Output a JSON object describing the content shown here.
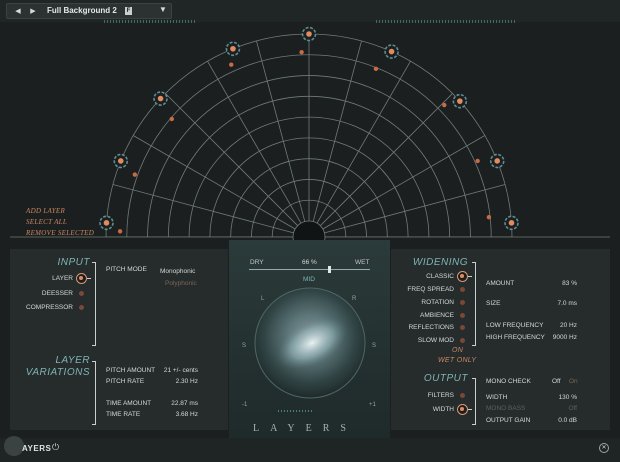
{
  "toolbar": {
    "prev": "◀",
    "next": "▶",
    "preset_name": "Full Background 2",
    "flag": "F",
    "caret": "▼"
  },
  "sound_field": {
    "actions": [
      "ADD LAYER",
      "SELECT ALL",
      "REMOVE SELECTED"
    ]
  },
  "input": {
    "title": "INPUT",
    "items": [
      {
        "label": "LAYER",
        "active": true
      },
      {
        "label": "DEESSER",
        "active": false
      },
      {
        "label": "COMPRESSOR",
        "active": false
      }
    ],
    "pitch_mode_label": "PITCH MODE",
    "pitch_mode_options": [
      "Monophonic",
      "Polyphonic"
    ]
  },
  "layer_variations": {
    "title_line1": "LAYER",
    "title_line2": "VARIATIONS",
    "params": [
      {
        "label": "PITCH AMOUNT",
        "value": "21 +/- cents"
      },
      {
        "label": "PITCH RATE",
        "value": "2.30 Hz"
      },
      {
        "label": "TIME AMOUNT",
        "value": "22.87 ms"
      },
      {
        "label": "TIME RATE",
        "value": "3.68 Hz"
      }
    ]
  },
  "mix": {
    "dry": "DRY",
    "wet": "WET",
    "value": "66 %",
    "fraction": 0.66
  },
  "scope": {
    "mid": "MID",
    "l": "L",
    "r": "R",
    "s_left": "S",
    "s_right": "S",
    "minus": "-1",
    "plus": "+1",
    "logo": "LAYERS"
  },
  "widening": {
    "title": "WIDENING",
    "modes": [
      {
        "label": "CLASSIC",
        "active": true
      },
      {
        "label": "FREQ SPREAD",
        "active": false
      },
      {
        "label": "ROTATION",
        "active": false
      },
      {
        "label": "AMBIENCE",
        "active": false
      },
      {
        "label": "REFLECTIONS",
        "active": false
      },
      {
        "label": "SLOW MOD",
        "active": false
      }
    ],
    "on": "ON",
    "wet_only": "WET ONLY",
    "params": [
      {
        "label": "AMOUNT",
        "value": "83 %"
      },
      {
        "label": "SIZE",
        "value": "7.0 ms"
      },
      {
        "label": "LOW FREQUENCY",
        "value": "20 Hz"
      },
      {
        "label": "HIGH FREQUENCY",
        "value": "9000 Hz"
      }
    ]
  },
  "output": {
    "title": "OUTPUT",
    "items": [
      {
        "label": "FILTERS",
        "active": false
      },
      {
        "label": "WIDTH",
        "active": true
      }
    ],
    "mono_check_label": "MONO CHECK",
    "mono_check_off": "Off",
    "mono_check_on": "On",
    "params": [
      {
        "label": "WIDTH",
        "value": "130 %"
      },
      {
        "label": "MONO BASS",
        "value": "Off"
      },
      {
        "label": "OUTPUT GAIN",
        "value": "0.0 dB"
      }
    ]
  },
  "footer": {
    "brand": "AYERS",
    "power": "⏻",
    "close": "✕"
  },
  "colors": {
    "accent": "#c86a44",
    "teal": "#7fb3b5",
    "bg": "#1b1f1f"
  }
}
